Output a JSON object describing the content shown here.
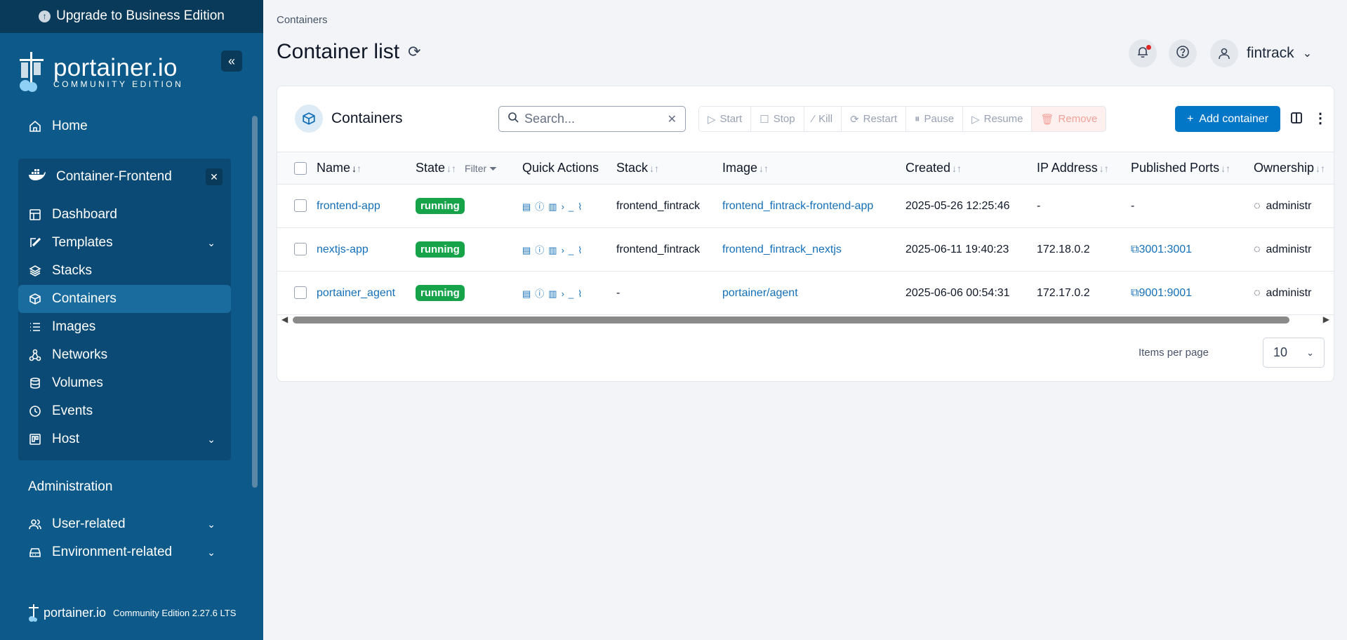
{
  "sidebar": {
    "upgrade_label": "Upgrade to Business Edition",
    "brand_name": "portainer.io",
    "brand_edition": "COMMUNITY EDITION",
    "home": "Home",
    "environment": "Container-Frontend",
    "env_items": [
      {
        "label": "Dashboard",
        "icon": "dashboard-icon"
      },
      {
        "label": "Templates",
        "icon": "templates-icon",
        "expandable": true
      },
      {
        "label": "Stacks",
        "icon": "stacks-icon"
      },
      {
        "label": "Containers",
        "icon": "containers-icon",
        "active": true
      },
      {
        "label": "Images",
        "icon": "images-icon"
      },
      {
        "label": "Networks",
        "icon": "networks-icon"
      },
      {
        "label": "Volumes",
        "icon": "volumes-icon"
      },
      {
        "label": "Events",
        "icon": "events-icon"
      },
      {
        "label": "Host",
        "icon": "host-icon",
        "expandable": true
      }
    ],
    "administration_label": "Administration",
    "admin_items": [
      {
        "label": "User-related",
        "icon": "users-icon"
      },
      {
        "label": "Environment-related",
        "icon": "environment-icon"
      }
    ],
    "footer_brand": "portainer.io",
    "footer_version": "Community Edition 2.27.6 LTS"
  },
  "header": {
    "breadcrumb": "Containers",
    "title": "Container list",
    "username": "fintrack"
  },
  "card": {
    "title": "Containers",
    "search_placeholder": "Search...",
    "actions": {
      "start": "Start",
      "stop": "Stop",
      "kill": "Kill",
      "restart": "Restart",
      "pause": "Pause",
      "resume": "Resume",
      "remove": "Remove"
    },
    "add_label": "Add container"
  },
  "table": {
    "headers": {
      "name": "Name",
      "state": "State",
      "filter": "Filter",
      "quick_actions": "Quick Actions",
      "stack": "Stack",
      "image": "Image",
      "created": "Created",
      "ip": "IP Address",
      "ports": "Published Ports",
      "ownership": "Ownership"
    },
    "rows": [
      {
        "name": "frontend-app",
        "state": "running",
        "stack": "frontend_fintrack",
        "image": "frontend_fintrack-frontend-app",
        "created": "2025-05-26 12:25:46",
        "ip": "-",
        "ports": "-",
        "ownership": "administr"
      },
      {
        "name": "nextjs-app",
        "state": "running",
        "stack": "frontend_fintrack",
        "image": "frontend_fintrack_nextjs",
        "created": "2025-06-11 19:40:23",
        "ip": "172.18.0.2",
        "ports": "3001:3001",
        "ownership": "administr"
      },
      {
        "name": "portainer_agent",
        "state": "running",
        "stack": "-",
        "image": "portainer/agent",
        "created": "2025-06-06 00:54:31",
        "ip": "172.17.0.2",
        "ports": "9001:9001",
        "ownership": "administr"
      }
    ]
  },
  "pagination": {
    "label": "Items per page",
    "value": "10"
  },
  "colors": {
    "sidebar": "#0d5a8a",
    "accent": "#0277c7",
    "running": "#16a34a"
  }
}
